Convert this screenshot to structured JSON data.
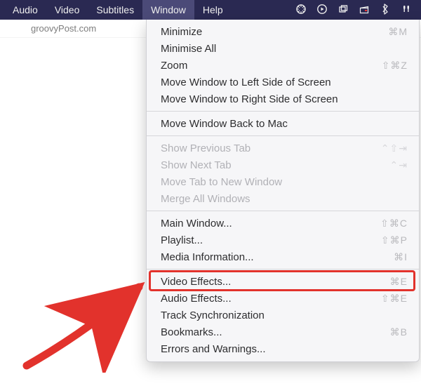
{
  "menubar": {
    "items": [
      {
        "label": "Audio",
        "active": false
      },
      {
        "label": "Video",
        "active": false
      },
      {
        "label": "Subtitles",
        "active": false
      },
      {
        "label": "Window",
        "active": true
      },
      {
        "label": "Help",
        "active": false
      }
    ]
  },
  "watermark": "groovyPost.com",
  "menu": {
    "groups": [
      [
        {
          "label": "Minimize",
          "shortcut": "⌘M",
          "enabled": true
        },
        {
          "label": "Minimise All",
          "shortcut": "",
          "enabled": true
        },
        {
          "label": "Zoom",
          "shortcut": "⇧⌘Z",
          "enabled": true
        },
        {
          "label": "Move Window to Left Side of Screen",
          "shortcut": "",
          "enabled": true
        },
        {
          "label": "Move Window to Right Side of Screen",
          "shortcut": "",
          "enabled": true
        }
      ],
      [
        {
          "label": "Move Window Back to Mac",
          "shortcut": "",
          "enabled": true
        }
      ],
      [
        {
          "label": "Show Previous Tab",
          "shortcut": "⌃⇧⇥",
          "enabled": false
        },
        {
          "label": "Show Next Tab",
          "shortcut": "⌃⇥",
          "enabled": false
        },
        {
          "label": "Move Tab to New Window",
          "shortcut": "",
          "enabled": false
        },
        {
          "label": "Merge All Windows",
          "shortcut": "",
          "enabled": false
        }
      ],
      [
        {
          "label": "Main Window...",
          "shortcut": "⇧⌘C",
          "enabled": true
        },
        {
          "label": "Playlist...",
          "shortcut": "⇧⌘P",
          "enabled": true
        },
        {
          "label": "Media Information...",
          "shortcut": "⌘I",
          "enabled": true
        }
      ],
      [
        {
          "label": "Video Effects...",
          "shortcut": "⌘E",
          "enabled": true,
          "highlight": true
        },
        {
          "label": "Audio Effects...",
          "shortcut": "⇧⌘E",
          "enabled": true
        },
        {
          "label": "Track Synchronization",
          "shortcut": "",
          "enabled": true
        },
        {
          "label": "Bookmarks...",
          "shortcut": "⌘B",
          "enabled": true
        },
        {
          "label": "Errors and Warnings...",
          "shortcut": "",
          "enabled": true
        }
      ]
    ]
  },
  "annotation": {
    "arrow_color": "#e2322c",
    "highlight_color": "#e2322c"
  }
}
